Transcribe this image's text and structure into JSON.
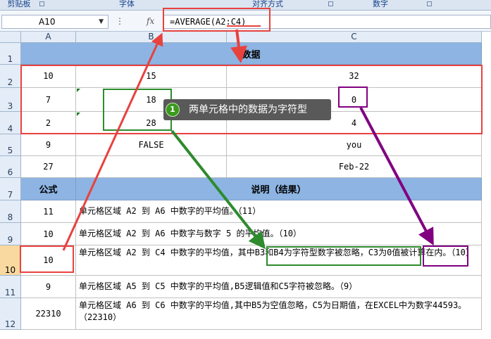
{
  "ribbon": {
    "groups": [
      "剪贴板",
      "字体",
      "对齐方式",
      "数字"
    ]
  },
  "formula_bar": {
    "name_box": "A10",
    "fx_label": "fx",
    "formula": "=AVERAGE(A2:C4)"
  },
  "columns": [
    "A",
    "B",
    "C"
  ],
  "rows": [
    "1",
    "2",
    "3",
    "4",
    "5",
    "6",
    "7",
    "8",
    "9",
    "10",
    "11",
    "12"
  ],
  "sheet": {
    "data_header": "数据",
    "data_rows": [
      [
        "10",
        "15",
        "32"
      ],
      [
        "7",
        "18",
        "0"
      ],
      [
        "2",
        "28",
        "4"
      ],
      [
        "9",
        "FALSE",
        "you"
      ],
      [
        "27",
        "",
        "Feb-22"
      ]
    ],
    "formula_header": "公式",
    "explain_header": "说明（结果）",
    "formula_rows": [
      [
        "11",
        "单元格区域 A2 到 A6 中数字的平均值。（11）"
      ],
      [
        "10",
        "单元格区域 A2 到 A6 中数字与数字 5 的平均值。（10）"
      ],
      [
        "10",
        "单元格区域 A2 到 C4 中数字的平均值，其中B3和B4为字符型数字被忽略，C3为0值被计算在内。（10）"
      ],
      [
        "9",
        "单元格区域 A5 到 C5 中数字的平均值,B5逻辑值和C5字符被忽略。（9）"
      ],
      [
        "22310",
        "单元格区域 A6 到 C6 中数字的平均值,其中B5为空值忽略，C5为日期值，在EXCEL中为数字44593。（22310）"
      ]
    ]
  },
  "callout": {
    "number": "1",
    "text": "两单元格中的数据为字符型"
  },
  "colors": {
    "red": "#e8423f",
    "green": "#2e8b2e",
    "purple": "#800080",
    "header_blue": "#8db4e2"
  }
}
